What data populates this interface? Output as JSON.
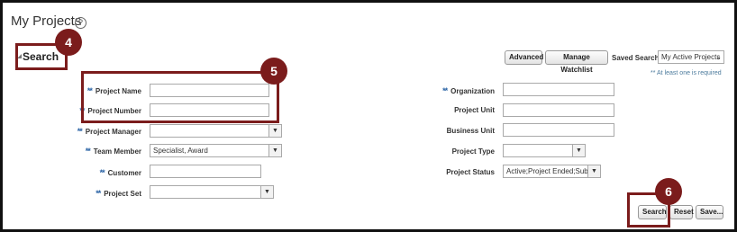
{
  "page": {
    "title": "My Projects",
    "help_icon": "question-circle-icon",
    "help_glyph": "?"
  },
  "search_panel": {
    "heading": "Search",
    "required_star": "**",
    "required_note": "** At least one is required"
  },
  "toolbar": {
    "advanced_label": "Advanced",
    "manage_watchlist_label": "Manage Watchlist",
    "saved_search_label": "Saved Search",
    "saved_search_value": "My Active Projects"
  },
  "fields_left": {
    "project_name": {
      "label": "Project Name",
      "value": ""
    },
    "project_number": {
      "label": "Project Number",
      "value": ""
    },
    "project_manager": {
      "label": "Project Manager",
      "value": ""
    },
    "team_member": {
      "label": "Team Member",
      "value": "Specialist, Award"
    },
    "customer": {
      "label": "Customer",
      "value": ""
    },
    "project_set": {
      "label": "Project Set",
      "value": ""
    }
  },
  "fields_right": {
    "organization": {
      "label": "Organization",
      "value": ""
    },
    "project_unit": {
      "label": "Project Unit",
      "value": ""
    },
    "business_unit": {
      "label": "Business Unit",
      "value": ""
    },
    "project_type": {
      "label": "Project Type",
      "value": ""
    },
    "project_status": {
      "label": "Project Status",
      "value": "Active;Project Ended;Subst"
    }
  },
  "actions": {
    "search_label": "Search",
    "reset_label": "Reset",
    "save_label": "Save..."
  },
  "callouts": {
    "c4": "4",
    "c5": "5",
    "c6": "6"
  },
  "colors": {
    "callout": "#7b1c1c",
    "required_star": "#2a63a5"
  }
}
